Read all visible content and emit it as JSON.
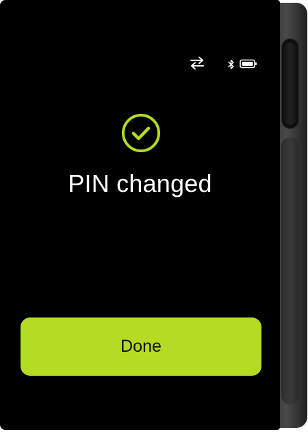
{
  "status_bar": {
    "usb_icon": "usb-transfer-icon",
    "bluetooth_icon": "bluetooth-icon",
    "battery_icon": "battery-icon",
    "battery_level": 1.0
  },
  "main": {
    "status_icon": "check-circle-icon",
    "title": "PIN changed"
  },
  "actions": {
    "done_label": "Done"
  },
  "colors": {
    "accent": "#b3dc22",
    "screen_background": "#000000",
    "text": "#ffffff"
  }
}
